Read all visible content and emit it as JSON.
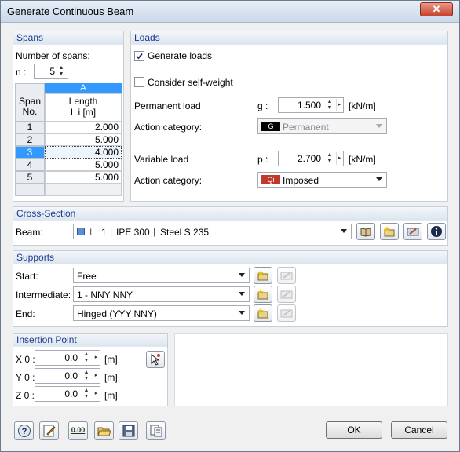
{
  "window": {
    "title": "Generate Continuous Beam",
    "close_glyph": "✕"
  },
  "spans": {
    "title": "Spans",
    "count_label": "Number of spans:",
    "n_label": "n :",
    "n_value": "5",
    "col_letter": "A",
    "col_header_line1": "Length",
    "col_header_line2": "L i [m]",
    "row_header_line1": "Span",
    "row_header_line2": "No.",
    "rows": [
      {
        "no": "1",
        "length": "2.000"
      },
      {
        "no": "2",
        "length": "5.000"
      },
      {
        "no": "3",
        "length": "4.000"
      },
      {
        "no": "4",
        "length": "5.000"
      },
      {
        "no": "5",
        "length": "5.000"
      }
    ]
  },
  "loads": {
    "title": "Loads",
    "generate_label": "Generate loads",
    "generate_checked": true,
    "selfweight_label": "Consider self-weight",
    "selfweight_checked": false,
    "permanent_label": "Permanent load",
    "permanent_symbol": "g :",
    "permanent_value": "1.500",
    "permanent_unit": "[kN/m]",
    "action_label_1": "Action category:",
    "action_1_badge": "G",
    "action_1_value": "Permanent",
    "variable_label": "Variable load",
    "variable_symbol": "p :",
    "variable_value": "2.700",
    "variable_unit": "[kN/m]",
    "action_label_2": "Action category:",
    "action_2_badge": "Qi",
    "action_2_value": "Imposed"
  },
  "cross_section": {
    "title": "Cross-Section",
    "beam_label": "Beam:",
    "beam_no": "1",
    "beam_profile": "IPE 300",
    "beam_material": "Steel S 235"
  },
  "supports": {
    "title": "Supports",
    "start_label": "Start:",
    "start_value": "Free",
    "intermediate_label": "Intermediate:",
    "intermediate_value": "1 - NNY NNY",
    "end_label": "End:",
    "end_value": "Hinged (YYY NNY)"
  },
  "insertion": {
    "title": "Insertion Point",
    "x_label": "X 0 :",
    "y_label": "Y 0 :",
    "z_label": "Z 0 :",
    "x_value": "0.0",
    "y_value": "0.0",
    "z_value": "0.0",
    "unit": "[m]"
  },
  "footer": {
    "ok": "OK",
    "cancel": "Cancel",
    "zero_icon_text": "0.00"
  },
  "colors": {
    "accent": "#3399ff",
    "group_title": "#1a3a8c",
    "badge_g": "#000000",
    "badge_q": "#c0392b"
  }
}
